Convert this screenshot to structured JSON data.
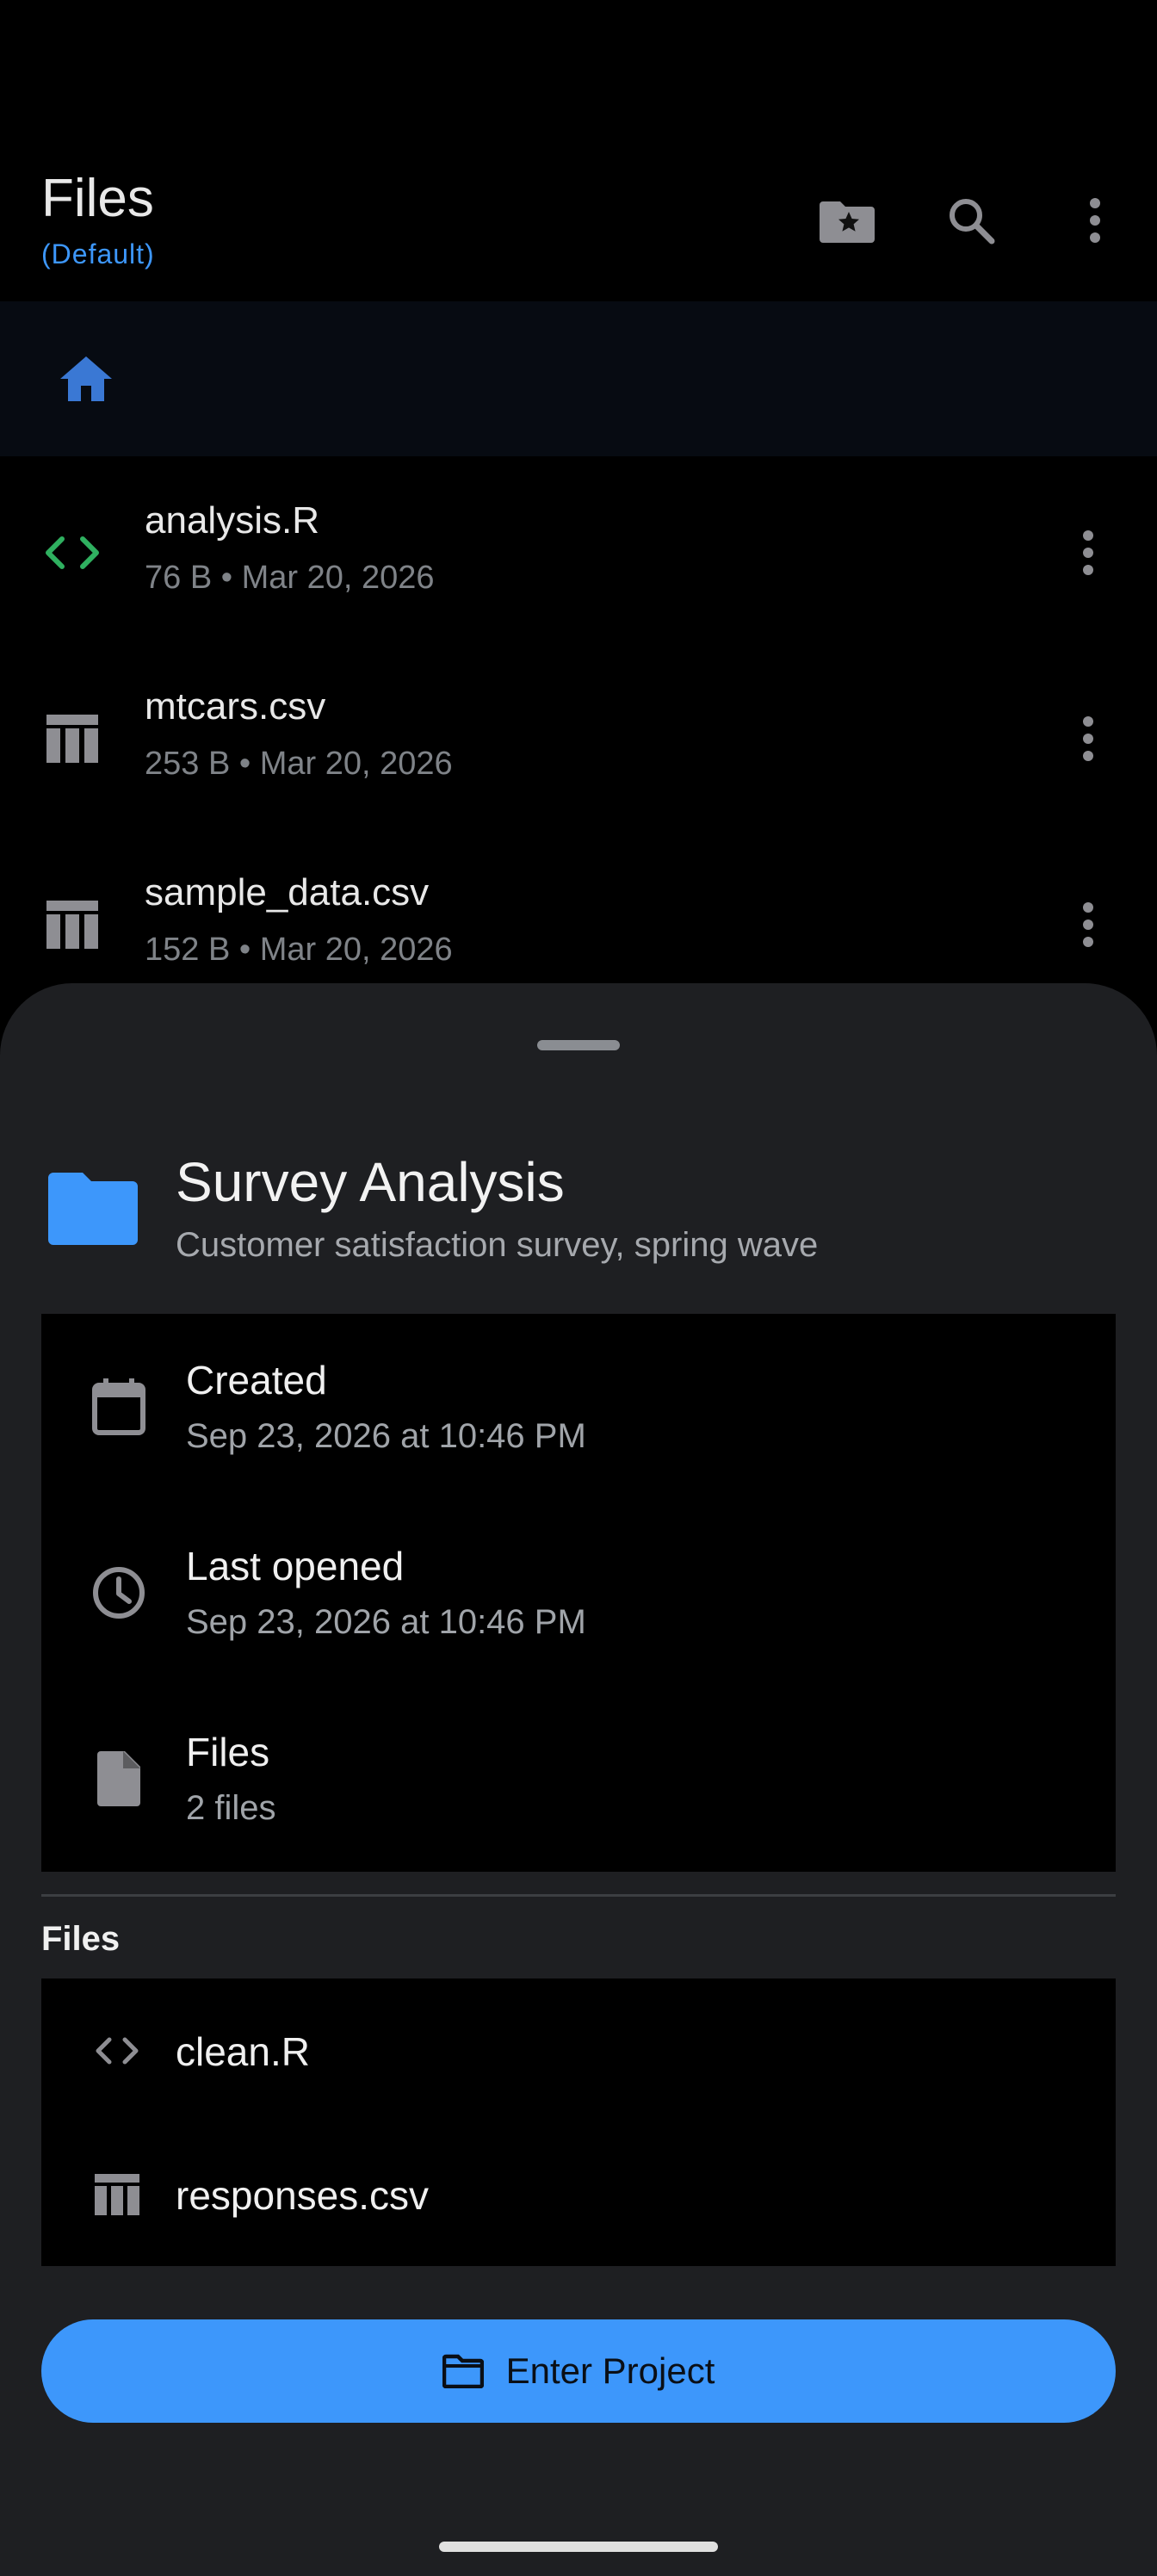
{
  "appbar": {
    "title": "Files",
    "subtitle": "(Default)",
    "actions": [
      "starred-folder-icon",
      "search-icon",
      "more-vert-icon"
    ]
  },
  "breadcrumb": {
    "icon": "home-icon"
  },
  "files": [
    {
      "name": "analysis.R",
      "meta": "76 B • Mar 20, 2026",
      "icon": "code-icon"
    },
    {
      "name": "mtcars.csv",
      "meta": "253 B • Mar 20, 2026",
      "icon": "table-icon"
    },
    {
      "name": "sample_data.csv",
      "meta": "152 B • Mar 20, 2026",
      "icon": "table-icon"
    }
  ],
  "sheet": {
    "project": {
      "title": "Survey Analysis",
      "description": "Customer satisfaction survey, spring wave"
    },
    "info": [
      {
        "label": "Created",
        "value": "Sep 23, 2026 at 10:46 PM",
        "icon": "calendar-icon"
      },
      {
        "label": "Last opened",
        "value": "Sep 23, 2026 at 10:46 PM",
        "icon": "clock-icon"
      },
      {
        "label": "Files",
        "value": "2 files",
        "icon": "file-icon"
      }
    ],
    "files_heading": "Files",
    "project_files": [
      {
        "name": "clean.R",
        "icon": "code-icon"
      },
      {
        "name": "responses.csv",
        "icon": "table-icon"
      }
    ],
    "enter_label": "Enter Project"
  },
  "colors": {
    "accent": "#3d97fb",
    "sheet_bg": "#1e1f22",
    "code_green": "#2fb060",
    "home_blue": "#3a78d4"
  }
}
